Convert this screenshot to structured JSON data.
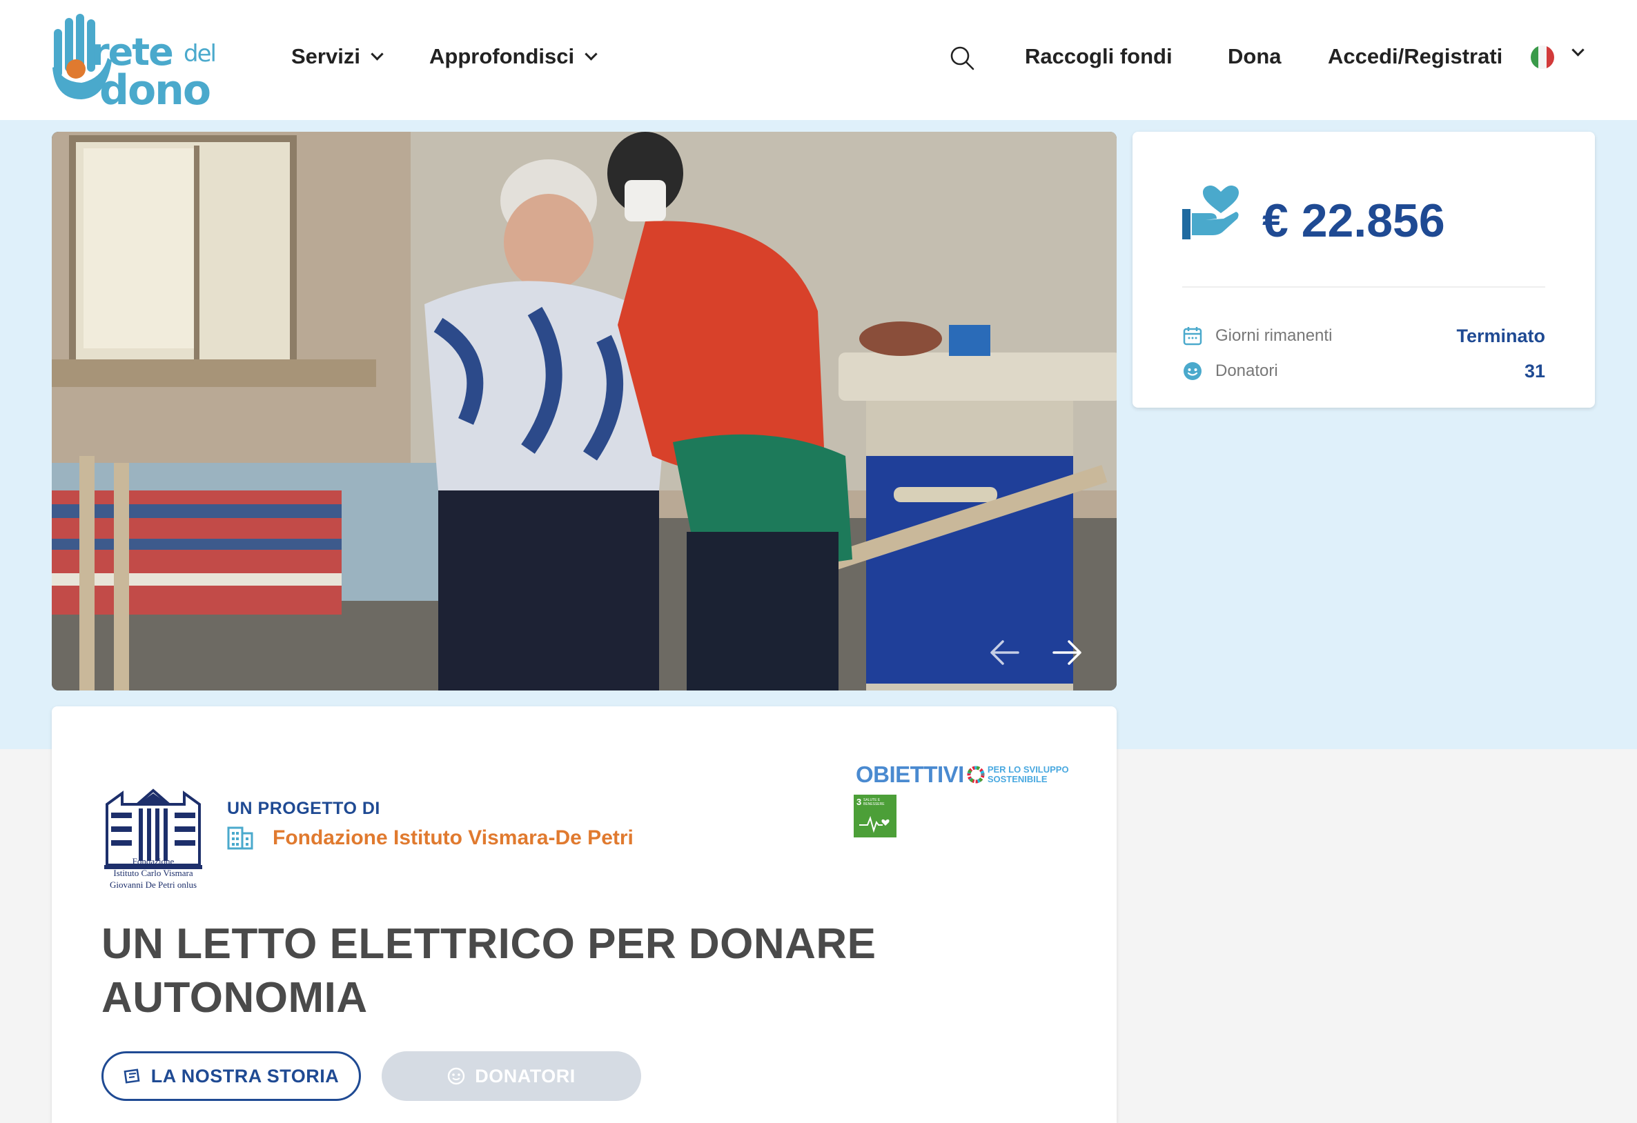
{
  "header": {
    "brand": {
      "rete": "rete",
      "del": "del",
      "dono": "dono"
    },
    "nav": [
      {
        "label": "Servizi"
      },
      {
        "label": "Approfondisci"
      }
    ],
    "actions": {
      "raccogli": "Raccogli fondi",
      "dona": "Dona",
      "accedi": "Accedi/Registrati"
    },
    "language": "Italiano"
  },
  "stats": {
    "amount": "€ 22.856",
    "days_label": "Giorni rimanenti",
    "days_value": "Terminato",
    "donors_label": "Donatori",
    "donors_value": "31"
  },
  "project": {
    "byline": "UN PROGETTO DI",
    "org_name": "Fondazione Istituto Vismara-De Petri",
    "org_logo_caption": [
      "Fondazione",
      "Istituto Carlo Vismara",
      "Giovanni De Petri onlus"
    ],
    "sdg": {
      "big": "OBIETTIVI",
      "small_1": "PER LO SVILUPPO",
      "small_2": "SOSTENIBILE",
      "goal_number": "3",
      "goal_text": "SALUTE E BENESSERE"
    },
    "title": "UN LETTO ELETTRICO PER DONARE AUTONOMIA",
    "buttons": {
      "story": "LA NOSTRA STORIA",
      "donors": "DONATORI"
    }
  },
  "colors": {
    "brand_blue": "#1f4a93",
    "brand_light_blue": "#4aa9cc",
    "accent_orange": "#e07a2f",
    "band_blue": "#dff0fa"
  }
}
